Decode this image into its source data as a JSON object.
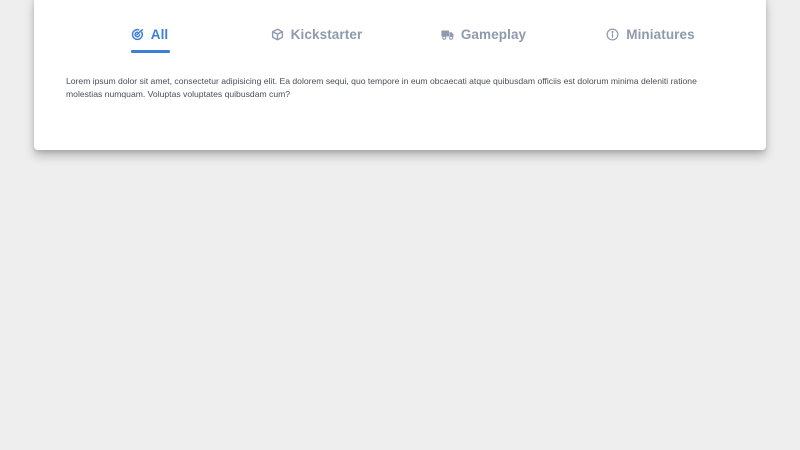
{
  "colors": {
    "accent": "#3d7fd6",
    "inactive_tab": "#8f9aad",
    "background": "#eeeeee",
    "card": "#ffffff"
  },
  "tabs": [
    {
      "label": "All",
      "icon": "tasks-icon",
      "active": true
    },
    {
      "label": "Kickstarter",
      "icon": "cube-icon",
      "active": false
    },
    {
      "label": "Gameplay",
      "icon": "truck-icon",
      "active": false
    },
    {
      "label": "Miniatures",
      "icon": "info-circle-icon",
      "active": false
    }
  ],
  "content": {
    "text": "Lorem ipsum dolor sit amet, consectetur adipisicing elit. Ea dolorem sequi, quo tempore in eum obcaecati atque quibusdam officiis est dolorum minima deleniti ratione molestias numquam. Voluptas voluptates quibusdam cum?"
  }
}
